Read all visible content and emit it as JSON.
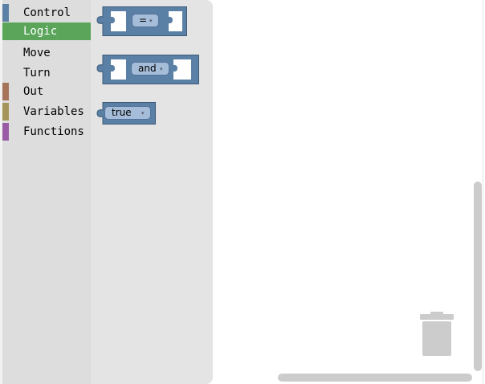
{
  "toolbox": {
    "categories": [
      {
        "label": "Control",
        "color": "#5b80a5"
      },
      {
        "label": "Logic",
        "color": "#5ba55b",
        "selected": true
      },
      {
        "label": "Move",
        "color": "#dddddd"
      },
      {
        "label": "Turn",
        "color": "#dddddd"
      },
      {
        "label": "Out",
        "color": "#a5745b"
      },
      {
        "label": "Variables",
        "color": "#a5955b"
      },
      {
        "label": "Functions",
        "color": "#995ba5"
      }
    ]
  },
  "flyout": {
    "blocks": [
      {
        "type": "logic_compare",
        "operator": "=",
        "dropdown_arrow": "▾"
      },
      {
        "type": "logic_operation",
        "operator": "and",
        "dropdown_arrow": "▾"
      },
      {
        "type": "logic_boolean",
        "value": "true",
        "dropdown_arrow": "▾"
      }
    ],
    "block_color": "#5b80a5",
    "block_stroke": "#3d5a7a"
  },
  "workspace": {
    "trash_icon": "trash-can-icon",
    "trash_color": "#cccccc"
  }
}
